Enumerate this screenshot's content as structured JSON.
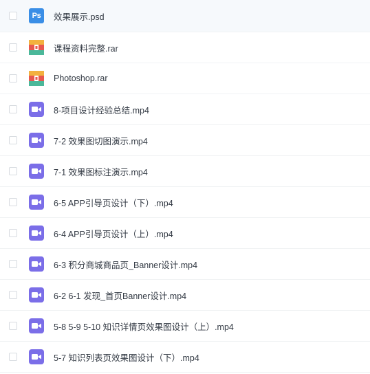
{
  "files": [
    {
      "name": "效果展示.psd",
      "type": "psd",
      "icon": "photoshop-file-icon",
      "badge": "Ps"
    },
    {
      "name": "课程资料完整.rar",
      "type": "rar",
      "icon": "archive-file-icon"
    },
    {
      "name": "Photoshop.rar",
      "type": "rar",
      "icon": "archive-file-icon"
    },
    {
      "name": "8-项目设计经验总结.mp4",
      "type": "video",
      "icon": "video-file-icon"
    },
    {
      "name": "7-2 效果图切图演示.mp4",
      "type": "video",
      "icon": "video-file-icon"
    },
    {
      "name": "7-1 效果图标注演示.mp4",
      "type": "video",
      "icon": "video-file-icon"
    },
    {
      "name": "6-5 APP引导页设计（下）.mp4",
      "type": "video",
      "icon": "video-file-icon"
    },
    {
      "name": "6-4 APP引导页设计（上）.mp4",
      "type": "video",
      "icon": "video-file-icon"
    },
    {
      "name": "6-3 积分商城商品页_Banner设计.mp4",
      "type": "video",
      "icon": "video-file-icon"
    },
    {
      "name": "6-2 6-1 发现_首页Banner设计.mp4",
      "type": "video",
      "icon": "video-file-icon"
    },
    {
      "name": "5-8 5-9 5-10 知识详情页效果图设计（上）.mp4",
      "type": "video",
      "icon": "video-file-icon"
    },
    {
      "name": "5-7 知识列表页效果图设计（下）.mp4",
      "type": "video",
      "icon": "video-file-icon"
    }
  ],
  "colors": {
    "psd": "#3a8ee6",
    "video": "#7b6ee8",
    "rar_top": "#f3b13f",
    "rar_mid": "#e8584f",
    "rar_bottom": "#4bb89a"
  }
}
